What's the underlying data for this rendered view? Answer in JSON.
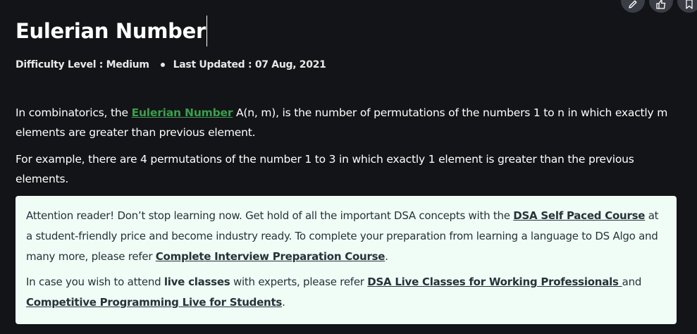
{
  "article": {
    "title": "Eulerian Number",
    "difficulty": "Difficulty Level : Medium",
    "last_updated": "Last Updated : 07 Aug, 2021"
  },
  "intro": {
    "p1_before": "In combinatorics, the ",
    "p1_link": "Eulerian Number",
    "p1_after": " A(n, m), is the number of permutations of the numbers 1 to n in which exactly m elements are greater than previous element.",
    "p2": "For example, there are 4 permutations of the number 1 to 3 in which exactly 1 element is greater than the previous elements."
  },
  "notice": {
    "p1_text1": "Attention reader! Don’t stop learning now. Get hold of all the important DSA concepts with the ",
    "p1_link1": "DSA Self Paced Course",
    "p1_text2": " at a student-friendly price and become industry ready.  To complete your preparation from learning a language to DS Algo and many more,  please refer ",
    "p1_link2": "Complete Interview Preparation Course",
    "p1_text3": ".",
    "p2_text1": "In case you wish to attend ",
    "p2_bold": "live classes",
    "p2_text2": " with experts, please refer ",
    "p2_link1": "DSA Live Classes for Working Professionals ",
    "p2_text3": "and ",
    "p2_link2": "Competitive Programming Live for Students",
    "p2_text4": "."
  },
  "icons": {
    "edit": "pencil-icon",
    "improve": "thumbs-up-icon",
    "bookmark": "bookmark-icon"
  },
  "colors": {
    "background": "#131417",
    "link_green": "#3b9e4e",
    "notice_bg": "#effdf6",
    "notice_text": "#273239"
  }
}
